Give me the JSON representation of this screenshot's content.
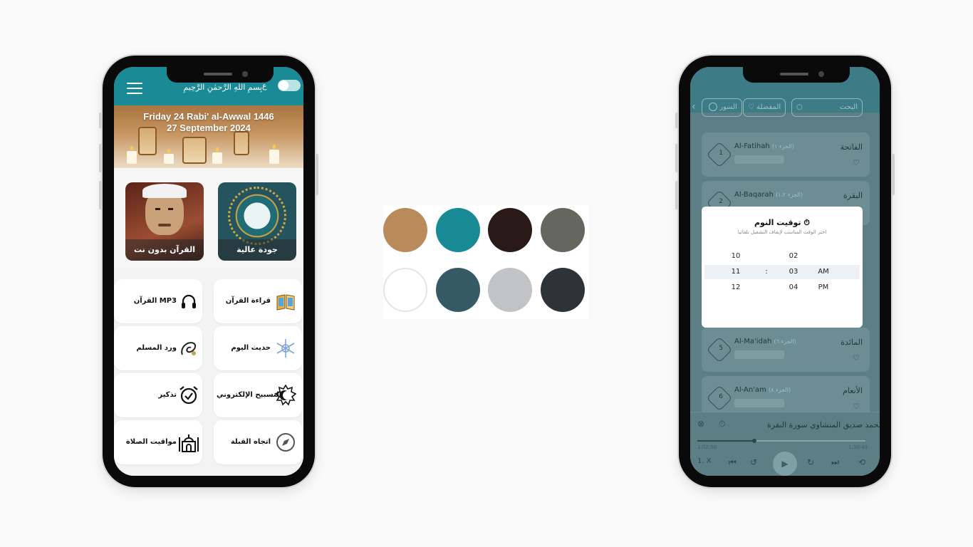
{
  "phone1": {
    "header": {
      "basmala": "بِسمِ اللهِ الرَّحمٰنِ الرَّحِيمِ",
      "toggle_letter": "ع"
    },
    "banner": {
      "hijri_date": "Friday 24 Rabi' al-Awwal 1446",
      "gregorian_date": "27 September 2024"
    },
    "cards": [
      {
        "label": "القرآن بدون نت"
      },
      {
        "label": "جودة عالية"
      }
    ],
    "tiles": [
      {
        "label": "القرآن MP3",
        "icon": "headphones-icon"
      },
      {
        "label": "قراءة القرآن",
        "icon": "book-icon"
      },
      {
        "label": "ورد المسلم",
        "icon": "calligraphy-icon"
      },
      {
        "label": "حديث اليوم",
        "icon": "snowflake-icon"
      },
      {
        "label": "تذكير",
        "icon": "alarm-clock-icon"
      },
      {
        "label": "التسبيح الإلكتروني",
        "icon": "crescent-star-icon"
      },
      {
        "label": "مواقيت الصلاة",
        "icon": "mosque-icon"
      },
      {
        "label": "اتجاه القبلة",
        "icon": "compass-icon"
      }
    ],
    "colors": {
      "primary": "#1a8a96"
    }
  },
  "palette": {
    "swatches": [
      "#b98a5a",
      "#178a95",
      "#2a1a17",
      "#65665d",
      "#ffffff",
      "#365966",
      "#c1c3c6",
      "#2e3239"
    ]
  },
  "phone2": {
    "search": {
      "placeholder": "البحث"
    },
    "filters": [
      {
        "label": "المفضلة"
      },
      {
        "label": "السور"
      }
    ],
    "suras": [
      {
        "number": "1",
        "name_en": "Al-Fatihah",
        "tag": "(الجزء ١)",
        "name_ar": "الفاتحة"
      },
      {
        "number": "2",
        "name_en": "Al-Baqarah",
        "tag": "(الجزء ١،٢)",
        "name_ar": "البقرة"
      },
      {
        "number": "5",
        "name_en": "Al-Ma'idah",
        "tag": "(الجزء ٦)",
        "name_ar": "المائدة"
      },
      {
        "number": "6",
        "name_en": "Al-An'am",
        "tag": "(الجزء ٨)",
        "name_ar": "الأنعام"
      }
    ],
    "sleep_timer": {
      "title": "توقيت النوم",
      "subtitle": "اختر الوقت المناسب لإيقاف التشغيل تلقائيا",
      "hours": [
        "10",
        "11",
        "12"
      ],
      "minutes": [
        "02",
        "03",
        "04"
      ],
      "periods": [
        "AM",
        "PM"
      ],
      "separator": ":"
    },
    "player": {
      "reciter": "محمد صديق المنشاوي",
      "sura": "سورة البقرة",
      "elapsed": "1:02:30",
      "total": "1:30:43",
      "speed": "1. X",
      "progress": 0.34
    }
  }
}
